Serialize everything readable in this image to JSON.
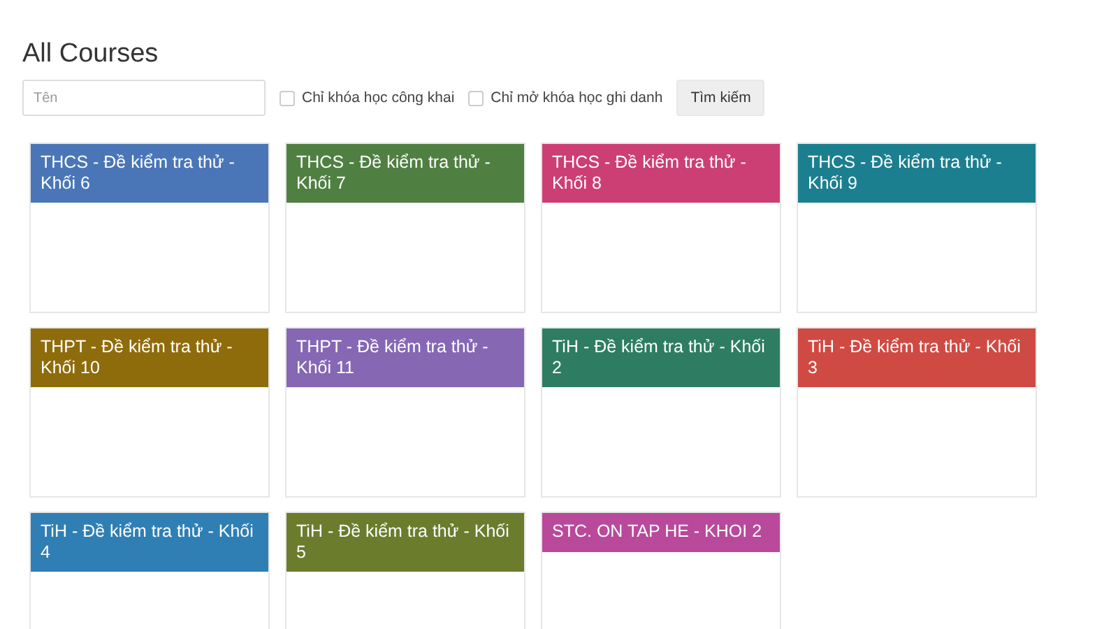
{
  "title": "All Courses",
  "search": {
    "placeholder": "Tên"
  },
  "filters": [
    {
      "label": "Chỉ khóa học công khai",
      "checked": false
    },
    {
      "label": "Chỉ mở khóa học ghi danh",
      "checked": false
    }
  ],
  "search_button": "Tìm kiếm",
  "courses": [
    {
      "title": "THCS - Đề kiểm tra thử - Khối 6",
      "color": "#4a76b8"
    },
    {
      "title": "THCS - Đề kiểm tra thử - Khối 7",
      "color": "#4f8042"
    },
    {
      "title": "THCS - Đề kiểm tra thử - Khối 8",
      "color": "#cc3f74"
    },
    {
      "title": "THCS - Đề kiểm tra thử - Khối 9",
      "color": "#1b7f8f"
    },
    {
      "title": "THPT - Đề kiểm tra thử - Khối 10",
      "color": "#8f6c0b"
    },
    {
      "title": "THPT - Đề kiểm tra thử - Khối 11",
      "color": "#8567b4"
    },
    {
      "title": "TiH - Đề kiểm tra thử - Khối 2",
      "color": "#2e7d63"
    },
    {
      "title": "TiH - Đề kiểm tra thử - Khối 3",
      "color": "#cf4a43"
    },
    {
      "title": "TiH - Đề kiểm tra thử - Khối 4",
      "color": "#2f7fb4"
    },
    {
      "title": "TiH - Đề kiểm tra thử - Khối 5",
      "color": "#6b7c2d"
    },
    {
      "title": "STC. ON TAP HE - KHOI 2",
      "color": "#b9499b"
    }
  ]
}
